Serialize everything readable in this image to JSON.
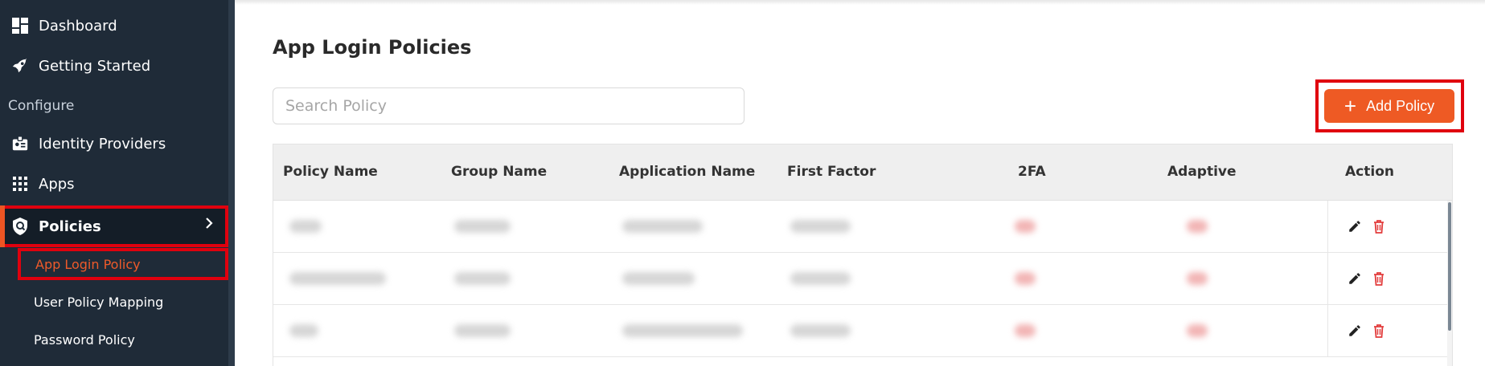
{
  "sidebar": {
    "items": [
      {
        "label": "Dashboard",
        "icon": "dashboard-icon"
      },
      {
        "label": "Getting Started",
        "icon": "rocket-icon"
      }
    ],
    "section_label": "Configure",
    "config_items": [
      {
        "label": "Identity Providers",
        "icon": "id-card-icon"
      },
      {
        "label": "Apps",
        "icon": "grid-icon"
      },
      {
        "label": "Policies",
        "icon": "shield-icon",
        "active": true
      }
    ],
    "sub_items": [
      {
        "label": "App Login Policy",
        "active": true
      },
      {
        "label": "User Policy Mapping"
      },
      {
        "label": "Password Policy"
      }
    ]
  },
  "main": {
    "title": "App Login Policies",
    "search": {
      "placeholder": "Search Policy",
      "value": ""
    },
    "add_button": {
      "label": "Add Policy",
      "icon": "plus-icon"
    },
    "table": {
      "columns": [
        "Policy Name",
        "Group Name",
        "Application Name",
        "First Factor",
        "2FA",
        "Adaptive",
        "Action"
      ],
      "row_actions": {
        "edit_icon": "pencil-icon",
        "delete_icon": "trash-icon"
      }
    }
  },
  "colors": {
    "sidebar_bg": "#1f2b38",
    "accent": "#ee5a24",
    "highlight_border": "#e0000e",
    "delete_icon": "#e23c3c"
  }
}
